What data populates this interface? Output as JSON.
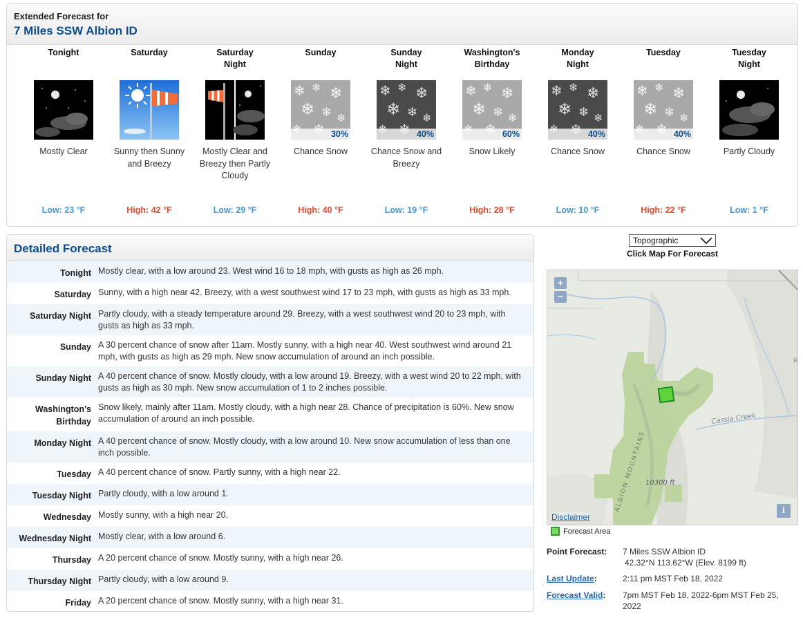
{
  "extended": {
    "subtitle": "Extended Forecast for",
    "location": "7 Miles SSW Albion ID",
    "periods": [
      {
        "name_l1": "Tonight",
        "name_l2": "",
        "icon": "night-mostly-clear-icon",
        "pop": "",
        "desc": "Mostly Clear",
        "temp": "Low: 23 °F",
        "kind": "low"
      },
      {
        "name_l1": "Saturday",
        "name_l2": "",
        "icon": "sunny-breezy-icon",
        "pop": "",
        "desc": "Sunny then Sunny and Breezy",
        "temp": "High: 42 °F",
        "kind": "high"
      },
      {
        "name_l1": "Saturday",
        "name_l2": "Night",
        "icon": "night-breezy-clouds-icon",
        "pop": "",
        "desc": "Mostly Clear and Breezy then Partly Cloudy",
        "temp": "Low: 29 °F",
        "kind": "low"
      },
      {
        "name_l1": "Sunday",
        "name_l2": "",
        "icon": "snow-day-icon",
        "pop": "30%",
        "desc": "Chance Snow",
        "temp": "High: 40 °F",
        "kind": "high"
      },
      {
        "name_l1": "Sunday",
        "name_l2": "Night",
        "icon": "snow-night-icon",
        "pop": "40%",
        "desc": "Chance Snow and Breezy",
        "temp": "Low: 19 °F",
        "kind": "low"
      },
      {
        "name_l1": "Washington's",
        "name_l2": "Birthday",
        "icon": "snow-day-icon",
        "pop": "60%",
        "desc": "Snow Likely",
        "temp": "High: 28 °F",
        "kind": "high"
      },
      {
        "name_l1": "Monday",
        "name_l2": "Night",
        "icon": "snow-night-icon",
        "pop": "40%",
        "desc": "Chance Snow",
        "temp": "Low: 10 °F",
        "kind": "low"
      },
      {
        "name_l1": "Tuesday",
        "name_l2": "",
        "icon": "snow-day-icon",
        "pop": "40%",
        "desc": "Chance Snow",
        "temp": "High: 22 °F",
        "kind": "high"
      },
      {
        "name_l1": "Tuesday",
        "name_l2": "Night",
        "icon": "night-partly-cloudy-icon",
        "pop": "",
        "desc": "Partly Cloudy",
        "temp": "Low: 1 °F",
        "kind": "low"
      }
    ]
  },
  "detailed": {
    "title": "Detailed Forecast",
    "rows": [
      {
        "label_l1": "Tonight",
        "label_l2": "",
        "text": "Mostly clear, with a low around 23. West wind 16 to 18 mph, with gusts as high as 26 mph."
      },
      {
        "label_l1": "Saturday",
        "label_l2": "",
        "text": "Sunny, with a high near 42. Breezy, with a west southwest wind 17 to 23 mph, with gusts as high as 33 mph."
      },
      {
        "label_l1": "Saturday Night",
        "label_l2": "",
        "text": "Partly cloudy, with a steady temperature around 29. Breezy, with a west southwest wind 20 to 23 mph, with gusts as high as 33 mph."
      },
      {
        "label_l1": "Sunday",
        "label_l2": "",
        "text": "A 30 percent chance of snow after 11am. Mostly sunny, with a high near 40. West southwest wind around 21 mph, with gusts as high as 29 mph. New snow accumulation of around an inch possible."
      },
      {
        "label_l1": "Sunday Night",
        "label_l2": "",
        "text": "A 40 percent chance of snow. Mostly cloudy, with a low around 19. Breezy, with a west wind 20 to 22 mph, with gusts as high as 30 mph. New snow accumulation of 1 to 2 inches possible."
      },
      {
        "label_l1": "Washington's",
        "label_l2": "Birthday",
        "text": "Snow likely, mainly after 11am. Mostly cloudy, with a high near 28. Chance of precipitation is 60%. New snow accumulation of around an inch possible."
      },
      {
        "label_l1": "Monday Night",
        "label_l2": "",
        "text": "A 40 percent chance of snow. Mostly cloudy, with a low around 10. New snow accumulation of less than one inch possible."
      },
      {
        "label_l1": "Tuesday",
        "label_l2": "",
        "text": "A 40 percent chance of snow. Partly sunny, with a high near 22."
      },
      {
        "label_l1": "Tuesday Night",
        "label_l2": "",
        "text": "Partly cloudy, with a low around 1."
      },
      {
        "label_l1": "Wednesday",
        "label_l2": "",
        "text": "Mostly sunny, with a high near 20."
      },
      {
        "label_l1": "Wednesday Night",
        "label_l2": "",
        "text": "Mostly clear, with a low around 6."
      },
      {
        "label_l1": "Thursday",
        "label_l2": "",
        "text": "A 20 percent chance of snow. Mostly sunny, with a high near 26."
      },
      {
        "label_l1": "Thursday Night",
        "label_l2": "",
        "text": "Partly cloudy, with a low around 9."
      },
      {
        "label_l1": "Friday",
        "label_l2": "",
        "text": "A 20 percent chance of snow. Mostly sunny, with a high near 31."
      }
    ]
  },
  "map": {
    "select_value": "Topographic",
    "caption": "Click Map For Forecast",
    "zoom_in": "+",
    "zoom_out": "−",
    "info": "i",
    "disclaimer": "Disclaimer",
    "legend": "Forecast Area",
    "labels": {
      "creek": "Cassia Creek",
      "mountains": "ALBION MOUNTAINS",
      "elevation": "10300 ft",
      "edge": "R"
    }
  },
  "info": {
    "point_label": "Point Forecast:",
    "point_l1": "7 Miles SSW Albion ID",
    "point_l2": "42.32°N 113.62°W (Elev. 8199 ft)",
    "update_label": "Last Update",
    "update_colon": ":",
    "update_val": "2:11 pm MST Feb 18, 2022",
    "valid_label": "Forecast Valid",
    "valid_colon": ":",
    "valid_l1": "7pm MST Feb 18, 2022-6pm MST Feb 25,",
    "valid_l2": "2022"
  },
  "colors": {
    "low_temp": "#3d9ad6",
    "high_temp": "#e8472b",
    "header_blue": "#0a4c8f",
    "link": "#2366b1"
  }
}
